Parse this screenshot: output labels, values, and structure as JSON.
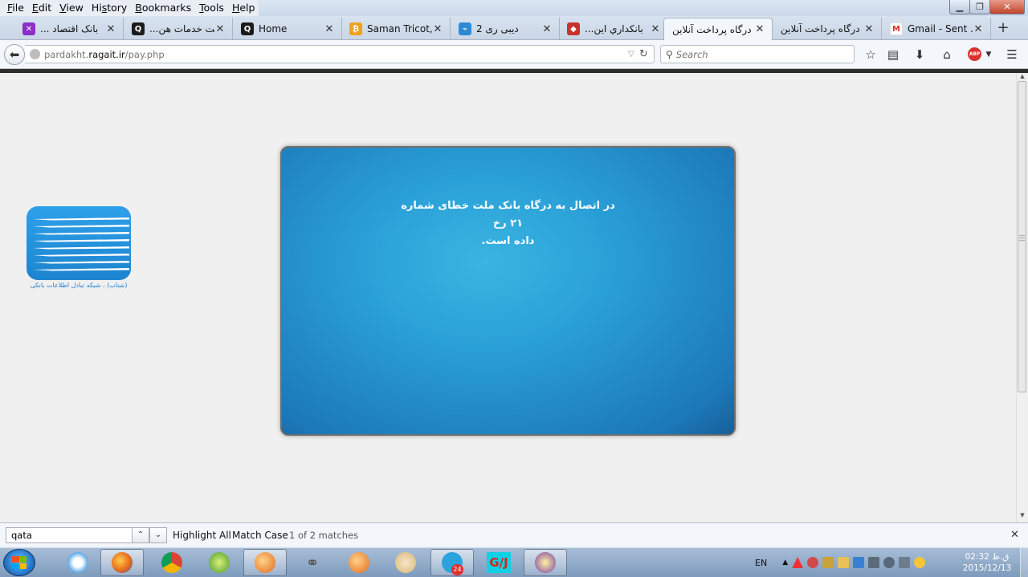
{
  "menu": [
    {
      "label": "File",
      "access_key": "F"
    },
    {
      "label": "Edit",
      "access_key": "E"
    },
    {
      "label": "View",
      "access_key": "V"
    },
    {
      "label": "History",
      "access_key": "s"
    },
    {
      "label": "Bookmarks",
      "access_key": "B"
    },
    {
      "label": "Tools",
      "access_key": "T"
    },
    {
      "label": "Help",
      "access_key": "H"
    }
  ],
  "tabs": [
    {
      "title": "... بانک اقتصاد",
      "favicon": "eghtesad-novin-icon",
      "color": "#8b2fc9",
      "active": false
    },
    {
      "title": "...شرکت خدمات هن",
      "favicon": "quora-like-icon",
      "color": "#1b1b1b",
      "active": false
    },
    {
      "title": "Home",
      "favicon": "quora-like-icon",
      "color": "#1b1b1b",
      "active": false
    },
    {
      "title": "Saman Tricot, ...",
      "favicon": "bitcoin-like-icon",
      "color": "#f0a21b",
      "active": false
    },
    {
      "title": "دیبی ری 2",
      "favicon": "chart-icon",
      "color": "#2d8bd6",
      "active": false
    },
    {
      "title": "...بانکداري اين",
      "favicon": "bank-logo-icon",
      "color": "#c8322c",
      "active": false
    },
    {
      "title": "درگاه پرداخت آنلاین",
      "favicon": "none",
      "color": "#ffffff",
      "active": true
    },
    {
      "title": "درگاه پرداخت آنلاین",
      "favicon": "none",
      "color": "#ffffff",
      "active": false
    },
    {
      "title": "Gmail - Sent ...",
      "favicon": "gmail-icon",
      "color": "#d93025",
      "active": false
    }
  ],
  "address": {
    "prefix": "pardakht.",
    "domain": "ragait.ir",
    "path": "/pay.php"
  },
  "search": {
    "placeholder": "Search"
  },
  "toolbar_icons": [
    "bookmark-star-icon",
    "reading-list-icon",
    "download-icon",
    "home-icon",
    "adblock-plus-icon",
    "hamburger-menu-icon"
  ],
  "adblock_label": "ABP",
  "page": {
    "logo_caption": "(شتاب) ، شبکه تبادل اطلاعات بانکی",
    "error_line1": "در اتصال به درگاه بانک ملت خطای شماره ۲۱ رخ",
    "error_line2": "داده است.",
    "panel_color": "#2aa0d8"
  },
  "findbar": {
    "query": "qata",
    "highlight_all": "Highlight All",
    "match_case": "Match Case",
    "match_count": "1 of 2 matches"
  },
  "taskbar": {
    "apps": [
      "start-orb",
      "search-app-icon",
      "firefox-icon",
      "chrome-icon",
      "corel-icon",
      "firefox-orange-icon",
      "chain-icon",
      "firefox-orange-icon-2",
      "paint-icon",
      "telegram-icon",
      "gj-icon",
      "yahoo-messenger-icon"
    ],
    "telegram_badge": "24",
    "gj_label": "G/J",
    "language": "EN",
    "time": "02:32 ق.ظ",
    "date": "2015/12/13"
  }
}
